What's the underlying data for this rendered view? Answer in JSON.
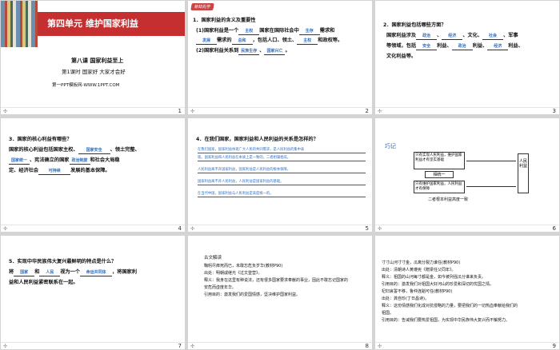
{
  "footer_icon": "ppt-icon",
  "slides": [
    {
      "num": "1",
      "unit_title": "第四单元 维护国家利益",
      "lesson": "第八课 国家利益至上",
      "sub": "第1课时 国家好 大家才会好",
      "site": "第一PPT模板网-WWW.1PPT.COM"
    },
    {
      "num": "2",
      "tag": "新知先学",
      "q": "1．国家利益的含义及重要性",
      "p1a": "(1)国家利益是一个",
      "f1": "主权",
      "p1b": "国家在国际社会中",
      "f2": "生存",
      "p1c": "需求和",
      "p2a": "",
      "f3": "发展",
      "p2b": "需求的",
      "f4": "总和",
      "p2c": "，包括人口、领土、",
      "f5": "主权",
      "p2d": "和政权等。",
      "p3a": "(2)国家利益关系到",
      "f6": "民族生存",
      "f7": "国家兴亡",
      "p3b": "。"
    },
    {
      "num": "3",
      "q": "2．国家利益包括哪些方面？",
      "p1a": "国家利益涉及",
      "f1": "政治",
      "f2": "经济",
      "p1b": "文化、",
      "f3": "社会",
      "p1c": "军事",
      "p2a": "等领域，包括",
      "f4": "安全",
      "p2b": "利益、",
      "f5": "政治",
      "p2c": "利益、",
      "f6": "经济",
      "p2d": "利益、",
      "p3": "文化利益等。"
    },
    {
      "num": "4",
      "q": "3．国家的核心利益有哪些？",
      "p1a": "国家的核心利益包括国家主权、",
      "f1": "国家安全",
      "p1b": "、领土完整、",
      "p2a": "国家统一",
      "p2b": "、宪法确立的国家",
      "f2": "政治制度",
      "p2c": "和社会大局稳",
      "p3a": "定、经济社会",
      "f3": "可持续",
      "p3b": "发展的基本保障。"
    },
    {
      "num": "5",
      "q": "4．在我们国家，国家利益和人民利益的关系是怎样的？",
      "l1": "在我们国家，国家利益体现广大人民的共同需求，是人民利益的集中表",
      "l2": "现。国家利益和人民利益在本质上是一致的，二者相辅相成。",
      "l3": "人民利益离不开国家利益，国家利益是人民利益的根本保障。",
      "l4": "国家利益离不开人民利益，人民利益是国家利益的基础。",
      "l5": "在当代中国，国家利益与人民利益是高度统一的。"
    },
    {
      "num": "6",
      "label": "巧记",
      "box_left": "只有实现人民利益，维护国家利益才有坚实基础",
      "box_mid": "相统一",
      "box_right": "人民利益",
      "box_left2": "只有维护国家利益，人民利益才有保障",
      "box_bottom": "二者根本利益高度一致"
    },
    {
      "num": "7",
      "q": "5．实现中华民族伟大复兴最鲜明的特点是什么？",
      "p1a": "将",
      "f1": "国家",
      "p1b": "和",
      "f2": "人民",
      "p1c": "视为一个",
      "f3": "命运共同体",
      "p1d": "，将国家利",
      "p2": "益和人民利益紧密联系在一起。"
    },
    {
      "num": "8",
      "title": "古文解读",
      "l1": "鞠躬尽瘁死而已，未敢忘危负岁华(教材P90)",
      "l2": "出处：明朝戚继光《过文登营》。",
      "l3": "释义：我身在这里有种说法，还有很多国家要求奉献的事业，因此不敢忘记国家的",
      "l4": "安危而虚度年华。",
      "l5": "引用目的：激发我们的爱国情感，坚决维护国家利益。"
    },
    {
      "num": "9",
      "l1": "寸寸山河寸寸金，瓜离分裂力谁任(教材P90)",
      "l2": "出处：清朝诗人黄遵宪《赠梁任父同年》。",
      "l3": "释义：祖国的山河每寸都是金，如今被列强瓜分谁来负责。",
      "l4": "引用目的：激发我们对祖国大好河山的珍爱和深切的忧国之情。",
      "l5": "杞妇哀誓不移，鲁仲连蹈可任(教材P90)",
      "l6": "出处：龚自珍(丁日昌诗)。",
      "l7": "释义：这份情感我们化成对抗侵略的力量，要把我们的一切热血奉献给我们的",
      "l8": "祖国。",
      "l9": "引用目的：告诫我们要热爱祖国，为实现中华民族伟大复兴而不懈努力。"
    }
  ]
}
